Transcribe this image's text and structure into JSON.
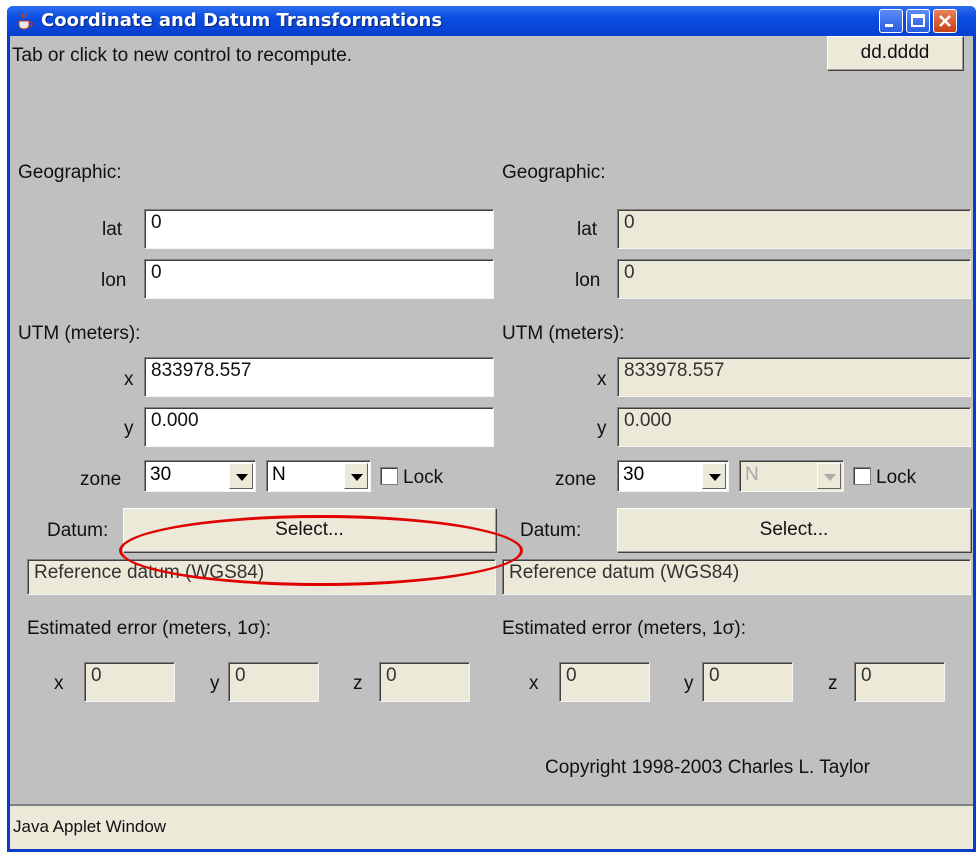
{
  "window": {
    "title": "Coordinate and Datum Transformations",
    "colors": {
      "titlebar": "#0a4ce0",
      "panel": "#c0c0c0",
      "field_readonly": "#ece9d8",
      "highlight": "#e00000"
    }
  },
  "toolbar": {
    "instruction": "Tab or click to new control to recompute.",
    "format_button": "dd.dddd"
  },
  "left": {
    "geo_label": "Geographic:",
    "lat_label": "lat",
    "lat_value": "0",
    "lon_label": "lon",
    "lon_value": "0",
    "utm_label": "UTM (meters):",
    "x_label": "x",
    "x_value": "833978.557",
    "y_label": "y",
    "y_value": "0.000",
    "zone_label": "zone",
    "zone_value": "30",
    "hemisphere_value": "N",
    "lock_label": "Lock",
    "datum_label": "Datum:",
    "select_button": "Select...",
    "datum_ref": "Reference datum (WGS84)",
    "error_label": "Estimated error (meters, 1σ):",
    "err_x_label": "x",
    "err_x_value": "0",
    "err_y_label": "y",
    "err_y_value": "0",
    "err_z_label": "z",
    "err_z_value": "0"
  },
  "right": {
    "geo_label": "Geographic:",
    "lat_label": "lat",
    "lat_value": "0",
    "lon_label": "lon",
    "lon_value": "0",
    "utm_label": "UTM (meters):",
    "x_label": "x",
    "x_value": "833978.557",
    "y_label": "y",
    "y_value": "0.000",
    "zone_label": "zone",
    "zone_value": "30",
    "hemisphere_value": "N",
    "lock_label": "Lock",
    "datum_label": "Datum:",
    "select_button": "Select...",
    "datum_ref": "Reference datum (WGS84)",
    "error_label": "Estimated error (meters, 1σ):",
    "err_x_label": "x",
    "err_x_value": "0",
    "err_y_label": "y",
    "err_y_value": "0",
    "err_z_label": "z",
    "err_z_value": "0"
  },
  "footer": {
    "copyright": "Copyright 1998-2003 Charles L. Taylor",
    "status": "Java Applet Window"
  },
  "icons": {
    "app": "java-cup-icon",
    "minimize": "minimize-icon",
    "maximize": "maximize-icon",
    "close": "close-icon"
  }
}
